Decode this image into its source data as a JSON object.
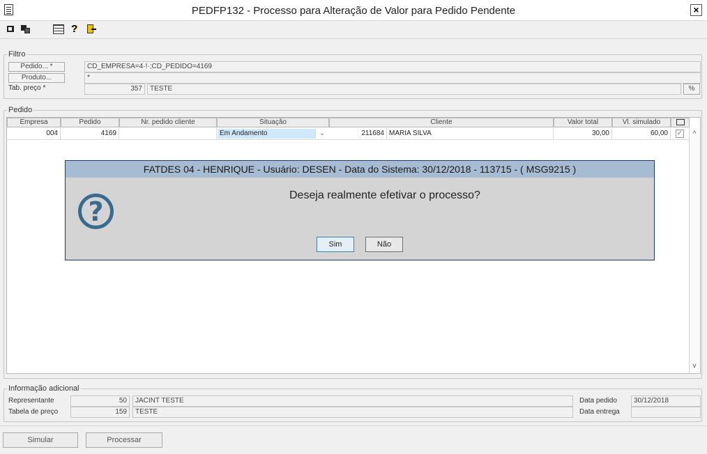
{
  "window": {
    "title": "PEDFP132 - Processo para Alteração de Valor para Pedido Pendente",
    "close_glyph": "×"
  },
  "toolbar": {
    "icons": [
      "exit-icon",
      "windows-icon",
      "grid-calendar-icon",
      "help-icon",
      "door-exit-icon"
    ],
    "help_glyph": "?"
  },
  "filtro": {
    "legend": "Filtro",
    "pedido_button": "Pedido... *",
    "pedido_value": "CD_EMPRESA=4·!·;CD_PEDIDO=4169",
    "produto_button": "Produto...",
    "produto_value": "*",
    "tab_preco_label": "Tab. preço *",
    "tab_preco_code": "357",
    "tab_preco_desc": "TESTE",
    "lookup_glyph": "%"
  },
  "pedido": {
    "legend": "Pedido",
    "columns": [
      "Empresa",
      "Pedido",
      "Nr. pedido cliente",
      "Situação",
      "Cliente",
      "Valor total",
      "Vl. simulado"
    ],
    "rows": [
      {
        "empresa": "004",
        "pedido": "4169",
        "nr_pedido_cliente": "",
        "situacao": "Em Andamento",
        "cliente_codigo": "211684",
        "cliente_nome": "MARIA SILVA",
        "valor_total": "30,00",
        "vl_simulado": "60,00",
        "checked": true
      }
    ],
    "check_glyph": "✓",
    "scroll_up_glyph": "^",
    "scroll_down_glyph": "v",
    "dropdown_glyph": "⌄"
  },
  "dialog": {
    "title": "FATDES 04 - HENRIQUE - Usuário: DESEN - Data do Sistema: 30/12/2018 - 113715 - ( MSG9215 )",
    "message": "Deseja realmente efetivar o processo?",
    "icon_glyph": "?",
    "yes_label": "Sim",
    "no_label": "Não"
  },
  "info": {
    "legend": "Informação adicional",
    "representante_label": "Representante",
    "representante_code": "50",
    "representante_name": "JACINT TESTE",
    "tabela_label": "Tabela de preço",
    "tabela_code": "159",
    "tabela_name": "TESTE",
    "data_pedido_label": "Data pedido",
    "data_pedido_value": "30/12/2018",
    "data_entrega_label": "Data entrega",
    "data_entrega_value": ""
  },
  "actions": {
    "simular_label": "Simular",
    "processar_label": "Processar"
  }
}
